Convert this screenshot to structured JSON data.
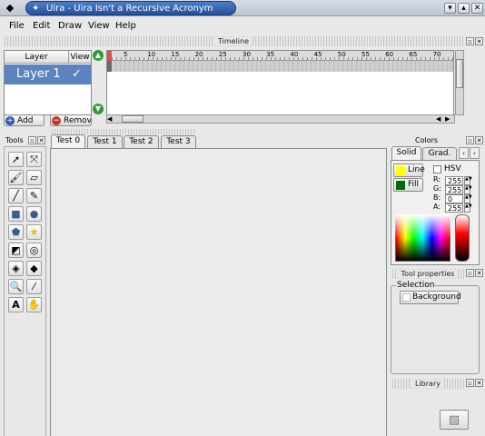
{
  "window": {
    "title": "Uira - Uira Isn't a Recursive Acronym",
    "controls": [
      "▾",
      "▴",
      "✕"
    ]
  },
  "menu": [
    {
      "label": "File"
    },
    {
      "label": "Edit"
    },
    {
      "label": "Draw"
    },
    {
      "label": "View"
    },
    {
      "label": "Help"
    }
  ],
  "timeline": {
    "title": "Timeline",
    "layer_header": "Layer",
    "view_header": "View",
    "layers": [
      {
        "name": "Layer 1",
        "visible_mark": "✓"
      }
    ],
    "ruler_ticks": [
      "5",
      "10",
      "15",
      "20",
      "25",
      "30",
      "35",
      "40",
      "45",
      "50",
      "55",
      "60",
      "65",
      "70"
    ],
    "add_label": "Add",
    "remove_label": "Remove"
  },
  "tools": {
    "title": "Tools",
    "items": [
      "arrow",
      "node",
      "brush",
      "eraser",
      "line",
      "pen",
      "rectangle",
      "ellipse",
      "polygon",
      "star",
      "transform",
      "spiral",
      "bucket-fill",
      "paint-bucket",
      "zoom",
      "eyedropper",
      "text",
      "hand"
    ]
  },
  "document_tabs": [
    "Test 0",
    "Test 1",
    "Test 2",
    "Test 3"
  ],
  "colors": {
    "title": "Colors",
    "tabs": [
      "Solid",
      "Grad."
    ],
    "line_label": "Line",
    "fill_label": "Fill",
    "line_color": "#ffff00",
    "fill_color": "#006d00",
    "hsv_label": "HSV",
    "channels": [
      {
        "label": "R:",
        "value": "255"
      },
      {
        "label": "G:",
        "value": "255"
      },
      {
        "label": "B:",
        "value": "0"
      },
      {
        "label": "A:",
        "value": "255"
      }
    ]
  },
  "tool_properties": {
    "title": "Tool properties",
    "group_label": "Selection",
    "background_label": "Background"
  },
  "library": {
    "title": "Library"
  }
}
